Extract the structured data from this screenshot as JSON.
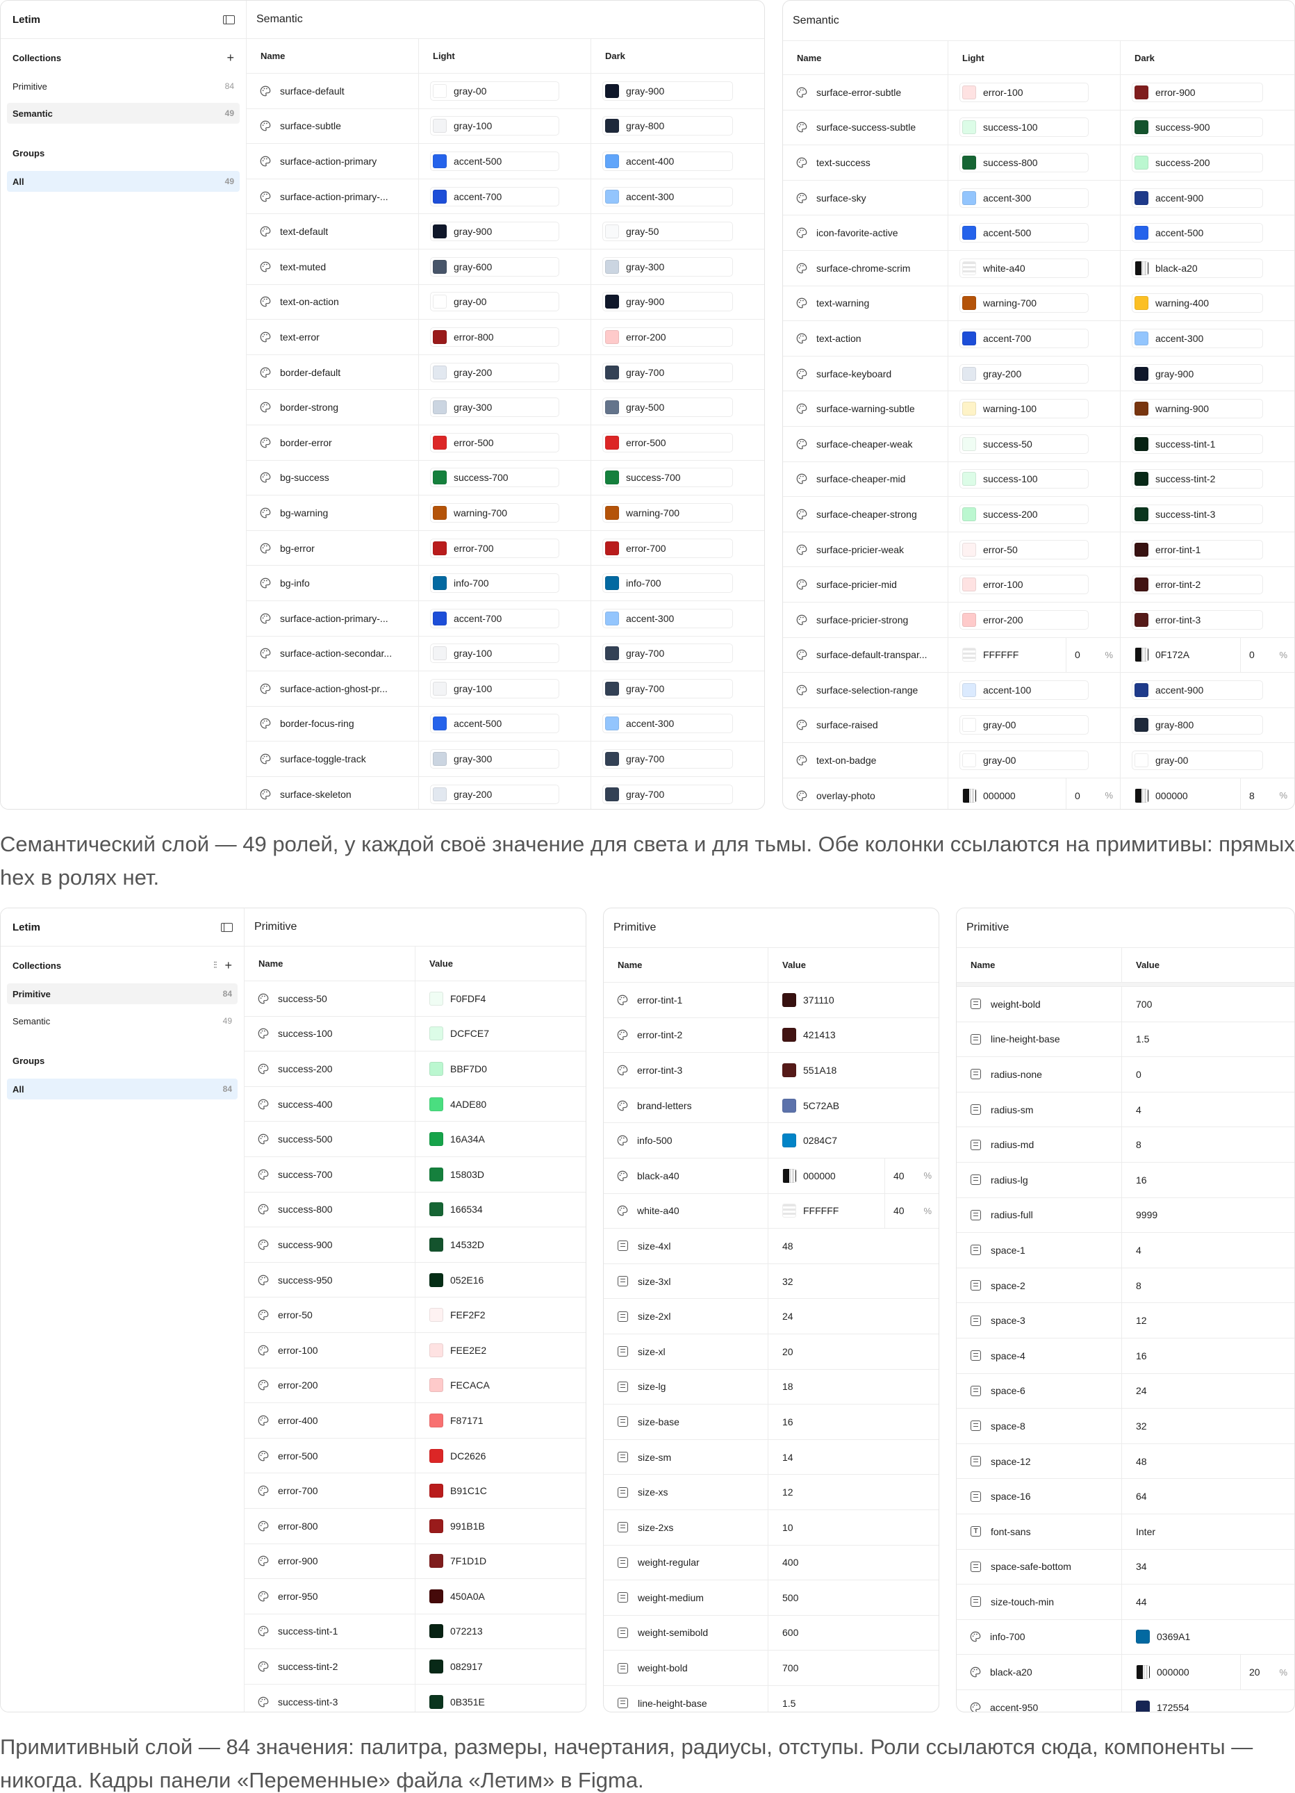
{
  "app_title": "Letim",
  "collections_label": "Collections",
  "groups_label": "Groups",
  "name_col": "Name",
  "light_col": "Light",
  "dark_col": "Dark",
  "value_col": "Value",
  "semantic_title": "Semantic",
  "primitive_title": "Primitive",
  "sidebar": [
    {
      "label": "Primitive",
      "count": "84"
    },
    {
      "label": "Semantic",
      "count": "49"
    }
  ],
  "all_label": "All",
  "all_count_semantic": "49",
  "all_count_primitive": "84",
  "caption1": "Семантический слой — 49 ролей, у каждой своё значение для света и для тьмы. Обе колонки ссылаются на примитивы: прямых hex в ролях нет.",
  "caption2": "Примитивный слой — 84 значения: палитра, размеры, начертания, радиусы, отступы. Роли ссылаются сюда, компоненты — никогда. Кадры панели «Переменные» файла «Летим» в Figma.",
  "colors": {
    "accent": "#2563eb",
    "sidebar_active": "#e7f2fd"
  },
  "sem1": [
    [
      "surface-default",
      "gray-00",
      "#ffffff",
      "gray-900",
      "#0f172a"
    ],
    [
      "surface-subtle",
      "gray-100",
      "#f3f4f6",
      "gray-800",
      "#1e293b"
    ],
    [
      "surface-action-primary",
      "accent-500",
      "#2563eb",
      "accent-400",
      "#60a5fa"
    ],
    [
      "surface-action-primary-...",
      "accent-700",
      "#1d4ed8",
      "accent-300",
      "#93c5fd"
    ],
    [
      "text-default",
      "gray-900",
      "#0f172a",
      "gray-50",
      "#f9fafb"
    ],
    [
      "text-muted",
      "gray-600",
      "#475569",
      "gray-300",
      "#cbd5e1"
    ],
    [
      "text-on-action",
      "gray-00",
      "#ffffff",
      "gray-900",
      "#0f172a"
    ],
    [
      "text-error",
      "error-800",
      "#991b1b",
      "error-200",
      "#fecaca"
    ],
    [
      "border-default",
      "gray-200",
      "#e2e8f0",
      "gray-700",
      "#334155"
    ],
    [
      "border-strong",
      "gray-300",
      "#cbd5e1",
      "gray-500",
      "#64748b"
    ],
    [
      "border-error",
      "error-500",
      "#dc2626",
      "error-500",
      "#dc2626"
    ],
    [
      "bg-success",
      "success-700",
      "#15803d",
      "success-700",
      "#15803d"
    ],
    [
      "bg-warning",
      "warning-700",
      "#b45309",
      "warning-700",
      "#b45309"
    ],
    [
      "bg-error",
      "error-700",
      "#b91c1c",
      "error-700",
      "#b91c1c"
    ],
    [
      "bg-info",
      "info-700",
      "#0369a1",
      "info-700",
      "#0369a1"
    ],
    [
      "surface-action-primary-...",
      "accent-700",
      "#1d4ed8",
      "accent-300",
      "#93c5fd"
    ],
    [
      "surface-action-secondar...",
      "gray-100",
      "#f3f4f6",
      "gray-700",
      "#334155"
    ],
    [
      "surface-action-ghost-pr...",
      "gray-100",
      "#f3f4f6",
      "gray-700",
      "#334155"
    ],
    [
      "border-focus-ring",
      "accent-500",
      "#2563eb",
      "accent-300",
      "#93c5fd"
    ],
    [
      "surface-toggle-track",
      "gray-300",
      "#cbd5e1",
      "gray-700",
      "#334155"
    ],
    [
      "surface-skeleton",
      "gray-200",
      "#e2e8f0",
      "gray-700",
      "#334155"
    ]
  ],
  "sem2": [
    [
      "surface-error-subtle",
      "error-100",
      "#fee2e2",
      "error-900",
      "#7f1d1d"
    ],
    [
      "surface-success-subtle",
      "success-100",
      "#dcfce7",
      "success-900",
      "#14532d"
    ],
    [
      "text-success",
      "success-800",
      "#166534",
      "success-200",
      "#bbf7d0"
    ],
    [
      "surface-sky",
      "accent-300",
      "#93c5fd",
      "accent-900",
      "#1e3a8a"
    ],
    [
      "icon-favorite-active",
      "accent-500",
      "#2563eb",
      "accent-500",
      "#2563eb"
    ],
    [
      "surface-chrome-scrim",
      "white-a40",
      "alpha-white",
      "black-a20",
      "alpha-black"
    ],
    [
      "text-warning",
      "warning-700",
      "#b45309",
      "warning-400",
      "#fbbf24"
    ],
    [
      "text-action",
      "accent-700",
      "#1d4ed8",
      "accent-300",
      "#93c5fd"
    ],
    [
      "surface-keyboard",
      "gray-200",
      "#e2e8f0",
      "gray-900",
      "#0f172a"
    ],
    [
      "surface-warning-subtle",
      "warning-100",
      "#fef3c7",
      "warning-900",
      "#78350f"
    ],
    [
      "surface-cheaper-weak",
      "success-50",
      "#f0fdf4",
      "success-tint-1",
      "#072213"
    ],
    [
      "surface-cheaper-mid",
      "success-100",
      "#dcfce7",
      "success-tint-2",
      "#082917"
    ],
    [
      "surface-cheaper-strong",
      "success-200",
      "#bbf7d0",
      "success-tint-3",
      "#0b351e"
    ],
    [
      "surface-pricier-weak",
      "error-50",
      "#fef2f2",
      "error-tint-1",
      "#371110"
    ],
    [
      "surface-pricier-mid",
      "error-100",
      "#fee2e2",
      "error-tint-2",
      "#421413"
    ],
    [
      "surface-pricier-strong",
      "error-200",
      "#fecaca",
      "error-tint-3",
      "#551a18"
    ],
    [
      "surface-default-transpar...",
      "FFFFFF",
      "alpha-white",
      "0F172A",
      "alpha-black",
      "0",
      "0"
    ],
    [
      "surface-selection-range",
      "accent-100",
      "#dbeafe",
      "accent-900",
      "#1e3a8a"
    ],
    [
      "surface-raised",
      "gray-00",
      "#ffffff",
      "gray-800",
      "#1e293b"
    ],
    [
      "text-on-badge",
      "gray-00",
      "#ffffff",
      "gray-00",
      "#ffffff"
    ],
    [
      "overlay-photo",
      "000000",
      "alpha-black",
      "000000",
      "alpha-black",
      "0",
      "8"
    ]
  ],
  "prim1": [
    [
      "c",
      "success-50",
      "F0FDF4",
      "#f0fdf4"
    ],
    [
      "c",
      "success-100",
      "DCFCE7",
      "#dcfce7"
    ],
    [
      "c",
      "success-200",
      "BBF7D0",
      "#bbf7d0"
    ],
    [
      "c",
      "success-400",
      "4ADE80",
      "#4ade80"
    ],
    [
      "c",
      "success-500",
      "16A34A",
      "#16a34a"
    ],
    [
      "c",
      "success-700",
      "15803D",
      "#15803d"
    ],
    [
      "c",
      "success-800",
      "166534",
      "#166534"
    ],
    [
      "c",
      "success-900",
      "14532D",
      "#14532d"
    ],
    [
      "c",
      "success-950",
      "052E16",
      "#052e16"
    ],
    [
      "c",
      "error-50",
      "FEF2F2",
      "#fef2f2"
    ],
    [
      "c",
      "error-100",
      "FEE2E2",
      "#fee2e2"
    ],
    [
      "c",
      "error-200",
      "FECACA",
      "#fecaca"
    ],
    [
      "c",
      "error-400",
      "F87171",
      "#f87171"
    ],
    [
      "c",
      "error-500",
      "DC2626",
      "#dc2626"
    ],
    [
      "c",
      "error-700",
      "B91C1C",
      "#b91c1c"
    ],
    [
      "c",
      "error-800",
      "991B1B",
      "#991b1b"
    ],
    [
      "c",
      "error-900",
      "7F1D1D",
      "#7f1d1d"
    ],
    [
      "c",
      "error-950",
      "450A0A",
      "#450a0a"
    ],
    [
      "c",
      "success-tint-1",
      "072213",
      "#072213"
    ],
    [
      "c",
      "success-tint-2",
      "082917",
      "#082917"
    ],
    [
      "c",
      "success-tint-3",
      "0B351E",
      "#0b351e"
    ]
  ],
  "prim2": [
    [
      "c",
      "error-tint-1",
      "371110",
      "#371110"
    ],
    [
      "c",
      "error-tint-2",
      "421413",
      "#421413"
    ],
    [
      "c",
      "error-tint-3",
      "551A18",
      "#551a18"
    ],
    [
      "c",
      "brand-letters",
      "5C72AB",
      "#5c72ab"
    ],
    [
      "c",
      "info-500",
      "0284C7",
      "#0284c7"
    ],
    [
      "a",
      "black-a40",
      "000000",
      "alpha-black",
      "40"
    ],
    [
      "a",
      "white-a40",
      "FFFFFF",
      "alpha-white",
      "40"
    ],
    [
      "n",
      "size-4xl",
      "48"
    ],
    [
      "n",
      "size-3xl",
      "32"
    ],
    [
      "n",
      "size-2xl",
      "24"
    ],
    [
      "n",
      "size-xl",
      "20"
    ],
    [
      "n",
      "size-lg",
      "18"
    ],
    [
      "n",
      "size-base",
      "16"
    ],
    [
      "n",
      "size-sm",
      "14"
    ],
    [
      "n",
      "size-xs",
      "12"
    ],
    [
      "n",
      "size-2xs",
      "10"
    ],
    [
      "n",
      "weight-regular",
      "400"
    ],
    [
      "n",
      "weight-medium",
      "500"
    ],
    [
      "n",
      "weight-semibold",
      "600"
    ],
    [
      "n",
      "weight-bold",
      "700"
    ],
    [
      "n",
      "line-height-base",
      "1.5"
    ]
  ],
  "prim3": [
    [
      "n",
      "weight-bold",
      "700"
    ],
    [
      "n",
      "line-height-base",
      "1.5"
    ],
    [
      "n",
      "radius-none",
      "0"
    ],
    [
      "n",
      "radius-sm",
      "4"
    ],
    [
      "n",
      "radius-md",
      "8"
    ],
    [
      "n",
      "radius-lg",
      "16"
    ],
    [
      "n",
      "radius-full",
      "9999"
    ],
    [
      "n",
      "space-1",
      "4"
    ],
    [
      "n",
      "space-2",
      "8"
    ],
    [
      "n",
      "space-3",
      "12"
    ],
    [
      "n",
      "space-4",
      "16"
    ],
    [
      "n",
      "space-6",
      "24"
    ],
    [
      "n",
      "space-8",
      "32"
    ],
    [
      "n",
      "space-12",
      "48"
    ],
    [
      "n",
      "space-16",
      "64"
    ],
    [
      "t",
      "font-sans",
      "Inter"
    ],
    [
      "n",
      "space-safe-bottom",
      "34"
    ],
    [
      "n",
      "size-touch-min",
      "44"
    ],
    [
      "c",
      "info-700",
      "0369A1",
      "#0369a1"
    ],
    [
      "a",
      "black-a20",
      "000000",
      "alpha-black",
      "20"
    ],
    [
      "c",
      "accent-950",
      "172554",
      "#172554"
    ]
  ]
}
